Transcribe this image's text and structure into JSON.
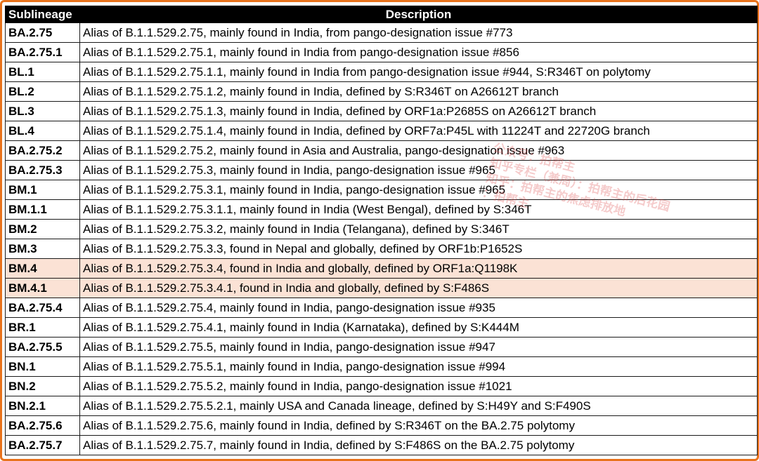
{
  "table": {
    "headers": [
      "Sublineage",
      "Description"
    ],
    "rows": [
      {
        "sublineage": "BA.2.75",
        "description": "Alias of B.1.1.529.2.75, mainly found in India, from pango-designation issue #773",
        "highlight": false
      },
      {
        "sublineage": "BA.2.75.1",
        "description": "Alias of B.1.1.529.2.75.1, mainly found in India from pango-designation issue #856",
        "highlight": false
      },
      {
        "sublineage": "BL.1",
        "description": "Alias of B.1.1.529.2.75.1.1, mainly found in India from pango-designation issue #944, S:R346T on polytomy",
        "highlight": false
      },
      {
        "sublineage": "BL.2",
        "description": "Alias of B.1.1.529.2.75.1.2, mainly found in India, defined by S:R346T on A26612T branch",
        "highlight": false
      },
      {
        "sublineage": "BL.3",
        "description": "Alias of B.1.1.529.2.75.1.3, mainly found in India, defined by ORF1a:P2685S on A26612T branch",
        "highlight": false
      },
      {
        "sublineage": "BL.4",
        "description": "Alias of B.1.1.529.2.75.1.4, mainly found in India, defined by ORF7a:P45L with 11224T and 22720G branch",
        "highlight": false
      },
      {
        "sublineage": "BA.2.75.2",
        "description": "Alias of B.1.1.529.2.75.2, mainly found in Asia and Australia, pango-designation issue #963",
        "highlight": false
      },
      {
        "sublineage": "BA.2.75.3",
        "description": "Alias of B.1.1.529.2.75.3, mainly found in India, pango-designation issue #965",
        "highlight": false
      },
      {
        "sublineage": "BM.1",
        "description": "Alias of B.1.1.529.2.75.3.1, mainly found in India, pango-designation issue #965",
        "highlight": false
      },
      {
        "sublineage": "BM.1.1",
        "description": "Alias of B.1.1.529.2.75.3.1.1, mainly found in India (West Bengal), defined by S:346T",
        "highlight": false
      },
      {
        "sublineage": "BM.2",
        "description": "Alias of B.1.1.529.2.75.3.2, mainly found in India (Telangana), defined by S:346T",
        "highlight": false
      },
      {
        "sublineage": "BM.3",
        "description": "Alias of B.1.1.529.2.75.3.3, found in Nepal and globally, defined by ORF1b:P1652S",
        "highlight": false
      },
      {
        "sublineage": "BM.4",
        "description": "Alias of B.1.1.529.2.75.3.4, found in India and globally, defined by ORF1a:Q1198K",
        "highlight": true
      },
      {
        "sublineage": "BM.4.1",
        "description": "Alias of B.1.1.529.2.75.3.4.1, found in India and globally, defined by S:F486S",
        "highlight": true
      },
      {
        "sublineage": "BA.2.75.4",
        "description": "Alias of B.1.1.529.2.75.4, mainly found in India, pango-designation issue #935",
        "highlight": false
      },
      {
        "sublineage": "BR.1",
        "description": "Alias of B.1.1.529.2.75.4.1, mainly found in India (Karnataka), defined by S:K444M",
        "highlight": false
      },
      {
        "sublineage": "BA.2.75.5",
        "description": "Alias of B.1.1.529.2.75.5, mainly found in India, pango-designation issue #947",
        "highlight": false
      },
      {
        "sublineage": "BN.1",
        "description": "Alias of B.1.1.529.2.75.5.1, mainly found in India, pango-designation issue #994",
        "highlight": false
      },
      {
        "sublineage": "BN.2",
        "description": "Alias of B.1.1.529.2.75.5.2, mainly found in India, pango-designation issue #1021",
        "highlight": false
      },
      {
        "sublineage": "BN.2.1",
        "description": "Alias of B.1.1.529.2.75.5.2.1, mainly USA and Canada lineage, defined by S:H49Y and S:F490S",
        "highlight": false
      },
      {
        "sublineage": "BA.2.75.6",
        "description": "Alias of B.1.1.529.2.75.6, mainly found in India, defined by S:R346T on the BA.2.75 polytomy",
        "highlight": false
      },
      {
        "sublineage": "BA.2.75.7",
        "description": "Alias of B.1.1.529.2.75.7, mainly found in India, defined by S:F486S on the BA.2.75 polytomy",
        "highlight": false
      }
    ]
  },
  "watermark": {
    "lines": [
      "公众号：拍帮主",
      "知乎专栏（兼周）：拍帮主的后花园",
      "知乎：拍帮主的焦虑排放地",
      "：拍帮主"
    ]
  },
  "colors": {
    "frame_border": "#e8731c",
    "header_bg": "#000000",
    "header_text": "#ffffff",
    "highlight_row": "#fbe2d5",
    "watermark": "#dc4646"
  }
}
